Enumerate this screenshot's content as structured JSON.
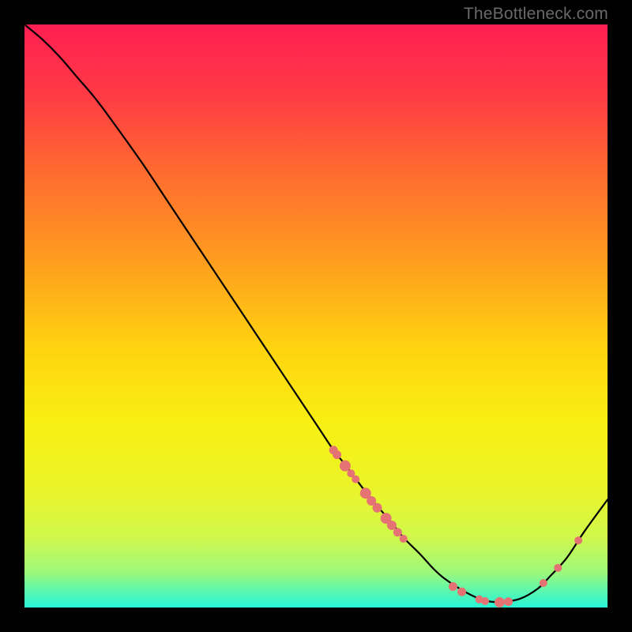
{
  "watermark": "TheBottleneck.com",
  "chart_data": {
    "type": "line",
    "title": "",
    "xlabel": "",
    "ylabel": "",
    "xlim": [
      0,
      100
    ],
    "ylim": [
      0,
      100
    ],
    "background_gradient": {
      "type": "vertical",
      "stops": [
        {
          "offset": 0,
          "color": "#ff1f52"
        },
        {
          "offset": 12,
          "color": "#ff3a45"
        },
        {
          "offset": 25,
          "color": "#ff6a30"
        },
        {
          "offset": 40,
          "color": "#ff9b1f"
        },
        {
          "offset": 55,
          "color": "#ffd210"
        },
        {
          "offset": 68,
          "color": "#f9ef12"
        },
        {
          "offset": 80,
          "color": "#eaf52a"
        },
        {
          "offset": 88,
          "color": "#d0f84c"
        },
        {
          "offset": 94,
          "color": "#9df87c"
        },
        {
          "offset": 97,
          "color": "#5ef7ac"
        },
        {
          "offset": 100,
          "color": "#27f5d6"
        }
      ]
    },
    "series": [
      {
        "name": "bottleneck-curve",
        "color": "#000000",
        "stroke_width": 2.2,
        "x": [
          0,
          3,
          6,
          9,
          12,
          15,
          20,
          25,
          30,
          35,
          40,
          45,
          50,
          53,
          55,
          58,
          60,
          63,
          65,
          68,
          70,
          72,
          75,
          78,
          80,
          82,
          85,
          88,
          90,
          93,
          96,
          100
        ],
        "y": [
          100,
          97.5,
          94.5,
          91,
          87.5,
          83.5,
          76.5,
          69,
          61.5,
          54,
          46.5,
          39,
          31.5,
          27,
          24.5,
          20.5,
          18,
          14.5,
          12,
          9,
          6.8,
          5,
          3,
          1.5,
          1,
          1,
          1.5,
          3.2,
          5.2,
          8.5,
          13,
          18.5
        ]
      }
    ],
    "markers": {
      "name": "highlight-points",
      "color": "#e57373",
      "radius_range": [
        4.5,
        8
      ],
      "points": [
        {
          "x": 53,
          "y": 27,
          "r": 5.5
        },
        {
          "x": 53.6,
          "y": 26.2,
          "r": 5.5
        },
        {
          "x": 55,
          "y": 24.3,
          "r": 7
        },
        {
          "x": 56,
          "y": 23,
          "r": 5
        },
        {
          "x": 56.8,
          "y": 22,
          "r": 5
        },
        {
          "x": 58.5,
          "y": 19.6,
          "r": 7
        },
        {
          "x": 59.5,
          "y": 18.3,
          "r": 6
        },
        {
          "x": 60.5,
          "y": 17.1,
          "r": 6
        },
        {
          "x": 62,
          "y": 15.3,
          "r": 7
        },
        {
          "x": 63,
          "y": 14.1,
          "r": 6
        },
        {
          "x": 64,
          "y": 12.9,
          "r": 5.5
        },
        {
          "x": 65,
          "y": 11.8,
          "r": 5
        },
        {
          "x": 73.5,
          "y": 3.6,
          "r": 5.5
        },
        {
          "x": 75,
          "y": 2.7,
          "r": 5.5
        },
        {
          "x": 78,
          "y": 1.4,
          "r": 5
        },
        {
          "x": 79,
          "y": 1.1,
          "r": 5
        },
        {
          "x": 81.5,
          "y": 0.9,
          "r": 6.5
        },
        {
          "x": 83,
          "y": 1.0,
          "r": 5.5
        },
        {
          "x": 89,
          "y": 4.2,
          "r": 5
        },
        {
          "x": 91.5,
          "y": 6.8,
          "r": 5
        },
        {
          "x": 95,
          "y": 11.5,
          "r": 5
        }
      ]
    }
  }
}
